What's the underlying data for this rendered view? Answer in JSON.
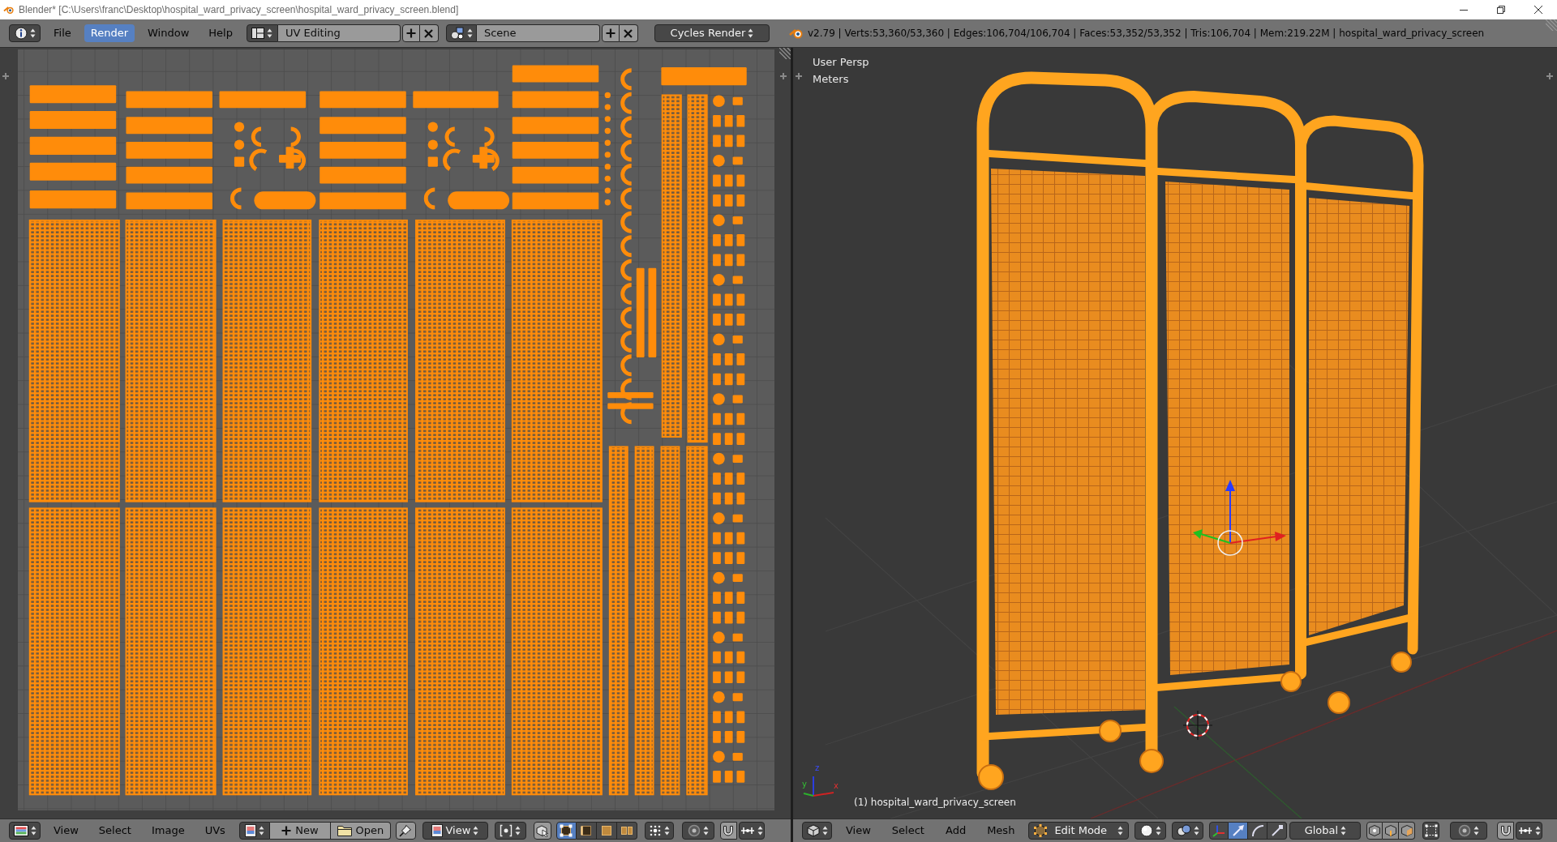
{
  "window": {
    "title": "Blender* [C:\\Users\\franc\\Desktop\\hospital_ward_privacy_screen\\hospital_ward_privacy_screen.blend]"
  },
  "info_header": {
    "menus": [
      {
        "label": "File",
        "selected": false
      },
      {
        "label": "Render",
        "selected": true
      },
      {
        "label": "Window",
        "selected": false
      },
      {
        "label": "Help",
        "selected": false
      }
    ],
    "screen_layout": "UV Editing",
    "scene": "Scene",
    "render_engine": "Cycles Render",
    "stats": "v2.79 | Verts:53,360/53,360 | Edges:106,704/106,704 | Faces:53,352/53,352 | Tris:106,704 | Mem:219.22M | hospital_ward_privacy_screen"
  },
  "uv_editor": {
    "header": {
      "menus": [
        "View",
        "Select",
        "Image",
        "UVs"
      ],
      "new_button": "New",
      "open_button": "Open",
      "view_menu": "View",
      "select_modes": [
        {
          "kind": "vertex",
          "selected": true
        },
        {
          "kind": "edge",
          "selected": false
        },
        {
          "kind": "face",
          "selected": false
        },
        {
          "kind": "island",
          "selected": false
        }
      ]
    }
  },
  "viewport_3d": {
    "view_name": "User Persp",
    "units": "Meters",
    "object_label": "(1) hospital_ward_privacy_screen",
    "axis_labels": [
      "z",
      "y",
      "x"
    ],
    "header": {
      "menus": [
        "View",
        "Select",
        "Add",
        "Mesh"
      ],
      "mode": "Edit Mode",
      "manipulators": [
        {
          "kind": "toggle",
          "selected": false
        },
        {
          "kind": "translate",
          "selected": true
        },
        {
          "kind": "rotate",
          "selected": false
        },
        {
          "kind": "scale",
          "selected": false
        }
      ],
      "transform_orientation": "Global"
    }
  }
}
